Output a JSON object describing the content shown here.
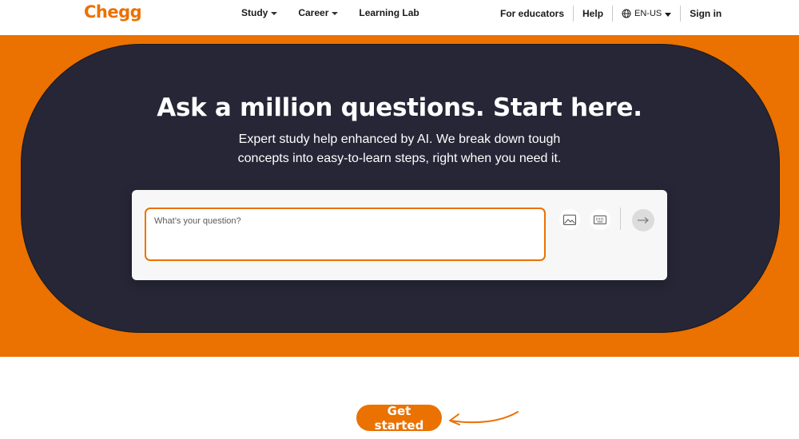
{
  "header": {
    "logo": "Chegg",
    "nav": [
      {
        "label": "Study",
        "has_dropdown": true
      },
      {
        "label": "Career",
        "has_dropdown": true
      },
      {
        "label": "Learning Lab",
        "has_dropdown": false
      }
    ],
    "right": {
      "educators": "For educators",
      "help": "Help",
      "language": "EN-US",
      "sign_in": "Sign in"
    }
  },
  "hero": {
    "title": "Ask a million questions. Start here.",
    "subtitle_line1": "Expert study help enhanced by AI. We break down tough",
    "subtitle_line2": "concepts into easy-to-learn steps, right when you need it.",
    "question_placeholder": "What’s your question?",
    "tools": [
      "image-upload-icon",
      "keyboard-icon"
    ],
    "submit_icon": "arrow-right-icon"
  },
  "cta": {
    "label": "Get started"
  },
  "colors": {
    "brand_orange": "#eb7100",
    "hero_dark": "#262637",
    "white": "#ffffff"
  }
}
